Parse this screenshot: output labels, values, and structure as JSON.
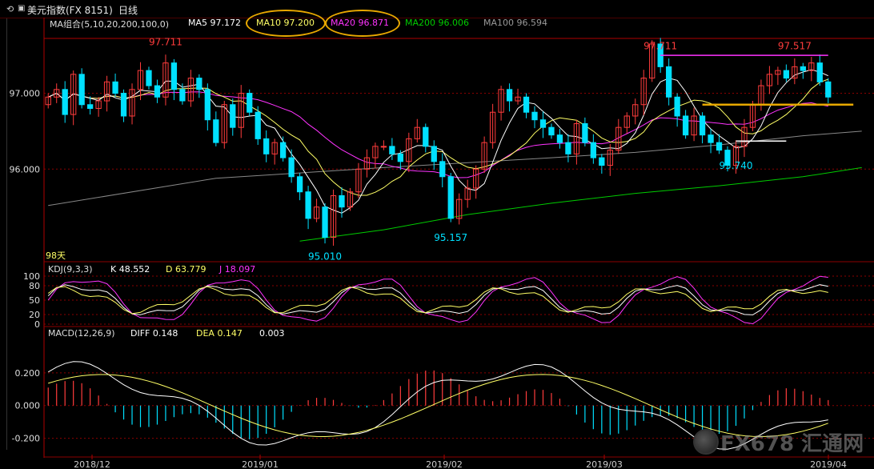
{
  "window": {
    "title": "美元指数(FX 8151)",
    "period": "日线",
    "icon_back": "refresh-icon",
    "icon_window": "window-icon"
  },
  "legend_ma": {
    "label": "MA组合(5,10,20,200,100,0)",
    "ma5": "MA5 97.172",
    "ma10": "MA10 97.200",
    "ma20": "MA20 96.871",
    "ma200": "MA200 96.006",
    "ma100": "MA100 96.594"
  },
  "legend_kdj": {
    "label": "KDJ(9,3,3)",
    "k": "K 48.552",
    "d": "D 63.779",
    "j": "J 18.097"
  },
  "legend_macd": {
    "label": "MACD(12,26,9)",
    "diff": "DIFF 0.148",
    "dea": "DEA 0.147",
    "val": "0.003"
  },
  "misc": {
    "days": "98天",
    "watermark": "FX678 汇通网"
  },
  "colors": {
    "up": "#ff3c3c",
    "down": "#00e0ff",
    "ma5": "#ffffff",
    "ma10": "#ffff66",
    "ma20": "#ff33ff",
    "ma200": "#00cc00",
    "ma100": "#888888",
    "highlight": "#e8a800",
    "kdj_k": "#ffffff",
    "kdj_d": "#ffff66",
    "kdj_j": "#ff33ff",
    "grid": "#8b0000"
  },
  "chart_data": [
    {
      "type": "candlestick",
      "title": "美元指数(FX 8151) 日线",
      "x_labels": [
        "2018/12",
        "2019/01",
        "2019/02",
        "2019/03",
        "2019/04"
      ],
      "y_ticks": [
        96.0,
        97.0
      ],
      "ylim": [
        94.8,
        97.85
      ],
      "annotations": [
        {
          "label": "97.711",
          "kind": "high",
          "index": 14
        },
        {
          "label": "95.010",
          "kind": "low",
          "index": 33
        },
        {
          "label": "95.157",
          "kind": "low",
          "index": 48
        },
        {
          "label": "97.711",
          "kind": "high",
          "index": 73
        },
        {
          "label": "95.740",
          "kind": "low",
          "index": 82
        },
        {
          "label": "97.517",
          "kind": "high",
          "index": 89
        }
      ],
      "horizontal_lines": [
        {
          "value": 97.5,
          "color": "#ff33ff",
          "from": 73,
          "to": 93
        },
        {
          "value": 96.85,
          "color": "#e8a800",
          "from": 78,
          "to": 96
        },
        {
          "value": 96.37,
          "color": "#ffffff",
          "from": 82,
          "to": 88
        }
      ],
      "closes": [
        96.95,
        97.05,
        96.72,
        97.25,
        96.85,
        96.8,
        96.9,
        97.15,
        97.0,
        96.7,
        97.05,
        97.3,
        97.1,
        96.95,
        97.4,
        97.05,
        96.9,
        97.2,
        97.05,
        96.65,
        96.35,
        96.85,
        96.55,
        97.0,
        96.75,
        96.4,
        96.2,
        96.35,
        96.15,
        95.9,
        95.7,
        95.35,
        95.5,
        95.1,
        95.65,
        95.5,
        95.7,
        96.0,
        96.15,
        96.3,
        96.3,
        96.2,
        96.1,
        96.4,
        96.55,
        96.3,
        96.1,
        95.9,
        95.35,
        95.6,
        95.75,
        96.0,
        96.35,
        96.75,
        97.05,
        96.9,
        96.95,
        96.75,
        96.65,
        96.55,
        96.45,
        96.35,
        96.2,
        96.6,
        96.35,
        96.15,
        96.05,
        96.25,
        96.55,
        96.7,
        96.85,
        97.2,
        97.65,
        97.35,
        96.95,
        96.7,
        96.45,
        96.7,
        96.45,
        96.35,
        96.25,
        96.05,
        96.3,
        96.55,
        96.85,
        97.1,
        97.25,
        97.3,
        97.2,
        97.35,
        97.3,
        97.4,
        97.15,
        96.95
      ],
      "ma200": [
        [
          0,
          95.52
        ],
        [
          20,
          95.88
        ],
        [
          40,
          96.02
        ],
        [
          60,
          96.15
        ],
        [
          70,
          96.22
        ],
        [
          80,
          96.32
        ],
        [
          90,
          96.44
        ],
        [
          97,
          96.5
        ]
      ],
      "ma200_low": [
        [
          30,
          95.05
        ],
        [
          40,
          95.2
        ],
        [
          50,
          95.4
        ],
        [
          60,
          95.55
        ],
        [
          70,
          95.68
        ],
        [
          80,
          95.78
        ],
        [
          90,
          95.9
        ],
        [
          97,
          96.02
        ]
      ],
      "macd_ylim": [
        -0.3,
        0.4
      ],
      "macd_ticks": [
        0.2,
        0.0,
        -0.2
      ],
      "kdj_ticks": [
        100,
        80,
        50,
        20,
        0
      ]
    }
  ]
}
